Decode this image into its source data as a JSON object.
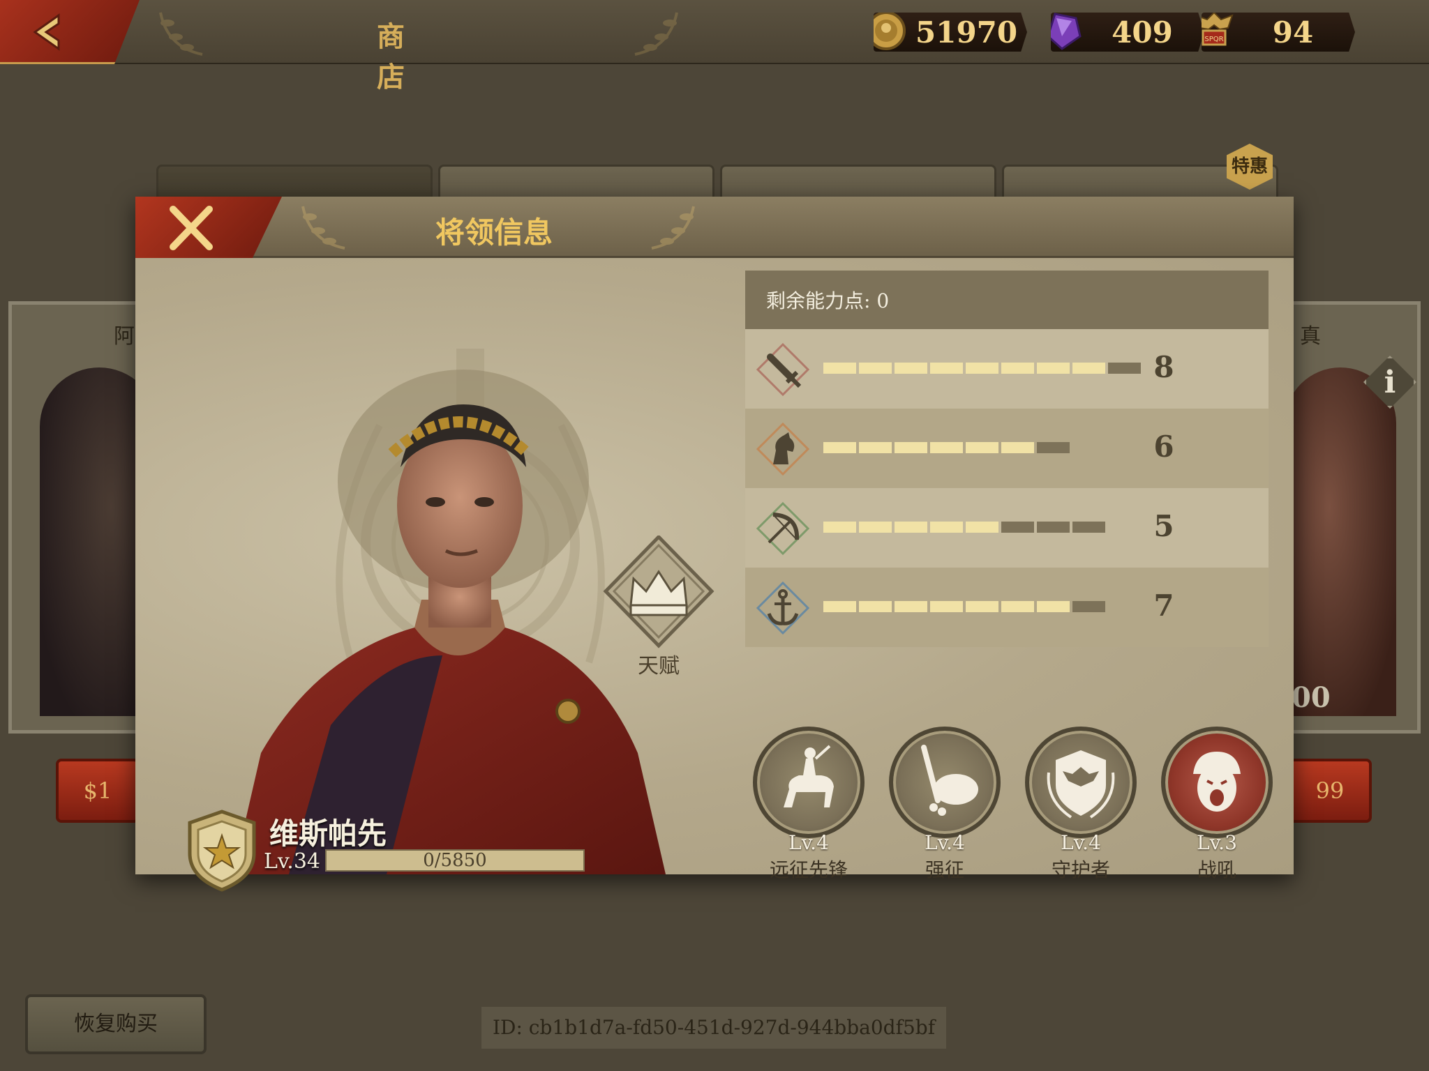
{
  "topbar": {
    "title": "商 店",
    "currencies": [
      {
        "icon": "gold-coin-icon",
        "value": "51970"
      },
      {
        "icon": "purple-gem-icon",
        "value": "409"
      },
      {
        "icon": "spqr-eagle-icon",
        "value": "94"
      }
    ]
  },
  "shop": {
    "special_badge": "特惠",
    "left_card_name": "阿",
    "left_price": "$1",
    "right_card_name": "真",
    "right_price": "99",
    "right_overlay_value": "00",
    "info_label": "i",
    "restore_label": "恢复购买",
    "id_text": "ID: cb1b1d7a-fd50-451d-927d-944bba0df5bf"
  },
  "dialog": {
    "title": "将领信息",
    "talent_label": "天赋",
    "general": {
      "name": "维斯帕先",
      "level": "Lv.34",
      "xp_text": "0/5850",
      "xp_fraction": 0.0
    },
    "stats_header": "剩余能力点: 0",
    "stats": [
      {
        "icon": "sword-icon",
        "value": "8",
        "filled": 8,
        "total": 9
      },
      {
        "icon": "cavalry-horse-icon",
        "value": "6",
        "filled": 6,
        "total": 7
      },
      {
        "icon": "bow-icon",
        "value": "5",
        "filled": 5,
        "total": 8
      },
      {
        "icon": "anchor-icon",
        "value": "7",
        "filled": 7,
        "total": 8
      }
    ],
    "skills": [
      {
        "icon": "mounted-knight-icon",
        "level": "Lv.4",
        "name": "远征先锋"
      },
      {
        "icon": "sword-and-sack-icon",
        "level": "Lv.4",
        "name": "强征"
      },
      {
        "icon": "eagle-shield-icon",
        "level": "Lv.4",
        "name": "守护者"
      },
      {
        "icon": "war-cry-soldier-icon",
        "level": "Lv.3",
        "name": "战吼"
      }
    ]
  },
  "colors": {
    "accent_red": "#a8311d",
    "gold_text": "#f0c760",
    "bar_on": "#f1e2a6",
    "bar_off": "#7d7259"
  }
}
